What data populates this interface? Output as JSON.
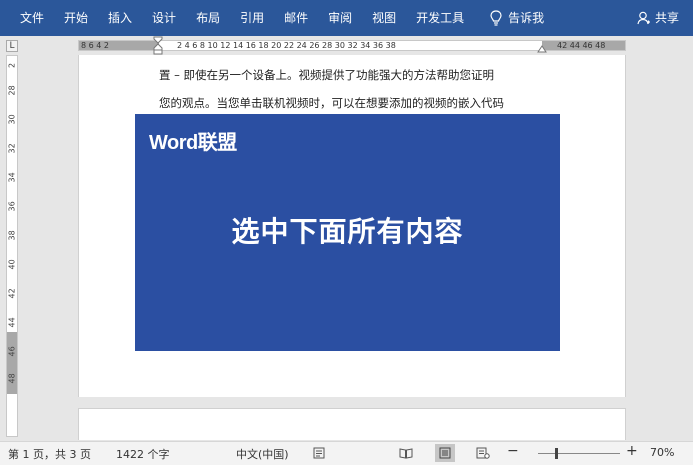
{
  "ribbon": {
    "tabs": [
      "文件",
      "开始",
      "插入",
      "设计",
      "布局",
      "引用",
      "邮件",
      "审阅",
      "视图",
      "开发工具"
    ],
    "tell_me": "告诉我",
    "share": "共享"
  },
  "ruler": {
    "tab_selector": "L",
    "left_numbers": "8  6  4  2",
    "main_numbers": "2   4   6   8  10  12  14  16  18  20  22  24  26  28  30  32  34  36  38",
    "right_numbers": "42  44  46  48",
    "vertical_numbers": [
      "2",
      "28",
      "30",
      "32",
      "34",
      "36",
      "38",
      "40",
      "42",
      "44",
      "46",
      "48"
    ]
  },
  "document": {
    "line1": "置 – 即使在另一个设备上。视频提供了功能强大的方法帮助您证明",
    "line2": "您的观点。当您单击联机视频时，可以在想要添加的视频的嵌入代码",
    "video": {
      "brand": "Word联盟",
      "caption": "选中下面所有内容"
    }
  },
  "status": {
    "page": "第 1 页，共 3 页",
    "words": "1422 个字",
    "language": "中文(中国)",
    "zoom_minus": "−",
    "zoom_plus": "+",
    "zoom": "70%"
  },
  "colors": {
    "ribbon": "#2b579a",
    "video_bg": "#2b4fa2"
  }
}
